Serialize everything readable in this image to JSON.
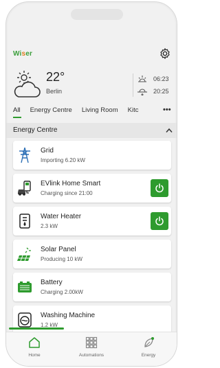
{
  "header": {
    "logo_left": "Wi",
    "logo_mid": "s",
    "logo_right": "er"
  },
  "weather": {
    "temperature": "22°",
    "city": "Berlin",
    "sunrise": "06:23",
    "sunset": "20:25"
  },
  "tabs": [
    {
      "label": "All",
      "active": true
    },
    {
      "label": "Energy Centre"
    },
    {
      "label": "Living Room"
    },
    {
      "label": "Kitc"
    }
  ],
  "more_label": "•••",
  "section": {
    "title": "Energy Centre"
  },
  "devices": [
    {
      "name": "Grid",
      "status": "Importing 6.20 kW",
      "icon": "grid-tower-icon"
    },
    {
      "name": "EVlink Home Smart",
      "status": "Charging since 21:00",
      "icon": "ev-charger-icon",
      "power": true
    },
    {
      "name": "Water Heater",
      "status": "2.3 kW",
      "icon": "water-heater-icon",
      "power": true
    },
    {
      "name": "Solar Panel",
      "status": "Producing 10 kW",
      "icon": "solar-panel-icon"
    },
    {
      "name": "Battery",
      "status": "Charging 2.00kW",
      "icon": "battery-icon"
    },
    {
      "name": "Washing Machine",
      "status": "1.2 kW",
      "icon": "washing-machine-icon"
    }
  ],
  "nav": [
    {
      "label": "Home",
      "icon": "home-icon",
      "active": true
    },
    {
      "label": "Automations",
      "icon": "grid-icon"
    },
    {
      "label": "Energy",
      "icon": "leaf-icon"
    }
  ],
  "colors": {
    "accent": "#2e9b2e",
    "logo_accent": "#e07a1e"
  }
}
